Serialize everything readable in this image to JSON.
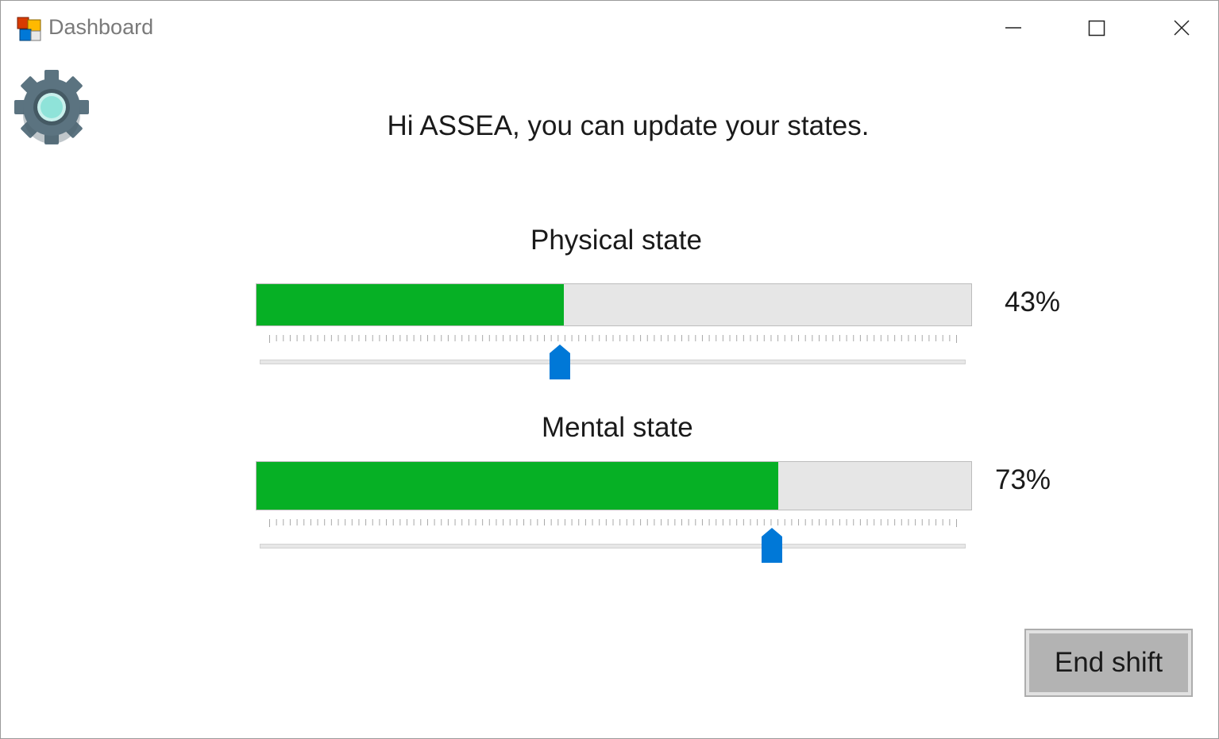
{
  "window": {
    "title": "Dashboard"
  },
  "greeting": "Hi ASSEA, you can update your states.",
  "physical": {
    "label": "Physical state",
    "value": 43,
    "value_text": "43%"
  },
  "mental": {
    "label": "Mental state",
    "value": 73,
    "value_text": "73%"
  },
  "end_button": {
    "label": "End shift"
  },
  "icons": {
    "app": "app-icon",
    "settings": "gear-icon",
    "minimize": "minimize-icon",
    "maximize": "maximize-icon",
    "close": "close-icon"
  },
  "colors": {
    "progress_fill": "#06b025",
    "progress_track": "#e6e6e6",
    "slider_thumb": "#0078d7",
    "button_face": "#b3b3b3"
  }
}
